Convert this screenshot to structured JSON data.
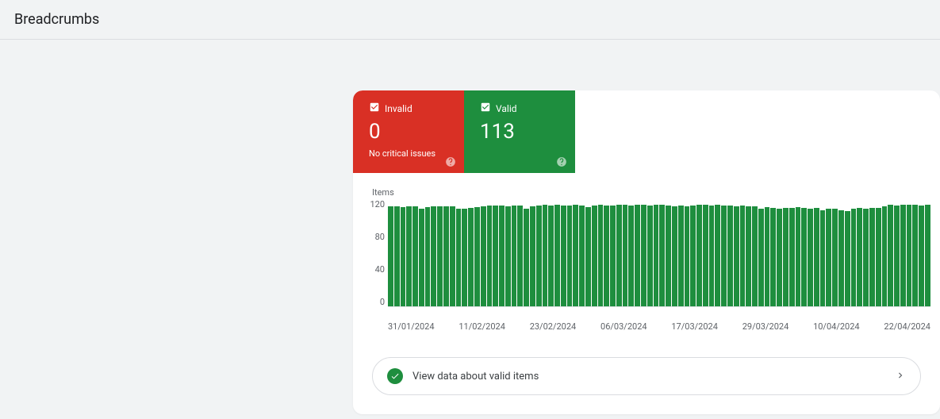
{
  "header": {
    "title": "Breadcrumbs"
  },
  "tabs": {
    "invalid": {
      "label": "Invalid",
      "count": "0",
      "subtext": "No critical issues"
    },
    "valid": {
      "label": "Valid",
      "count": "113"
    }
  },
  "link_row": {
    "text": "View data about valid items"
  },
  "chart_data": {
    "type": "bar",
    "title": "Items",
    "ylabel": "Items",
    "xlabel": "",
    "ylim": [
      0,
      120
    ],
    "yticks": [
      "120",
      "80",
      "40",
      "0"
    ],
    "xticks": [
      "31/01/2024",
      "11/02/2024",
      "23/02/2024",
      "06/03/2024",
      "17/03/2024",
      "29/03/2024",
      "10/04/2024",
      "22/04/2024"
    ],
    "values": [
      112,
      112,
      111,
      112,
      112,
      109,
      111,
      112,
      112,
      112,
      112,
      109,
      109,
      110,
      111,
      112,
      113,
      113,
      113,
      112,
      113,
      113,
      109,
      112,
      113,
      114,
      113,
      114,
      113,
      113,
      114,
      113,
      111,
      113,
      114,
      113,
      113,
      114,
      114,
      113,
      114,
      114,
      113,
      114,
      114,
      113,
      112,
      113,
      112,
      113,
      114,
      114,
      113,
      114,
      113,
      113,
      112,
      113,
      112,
      112,
      109,
      111,
      110,
      109,
      110,
      110,
      111,
      110,
      109,
      110,
      108,
      109,
      109,
      108,
      107,
      109,
      110,
      109,
      110,
      110,
      112,
      114,
      113,
      114,
      114,
      114,
      113,
      114
    ],
    "categories_note": "Daily bars from 31/01/2024 to ~28/04/2024, all series Valid (green)."
  }
}
